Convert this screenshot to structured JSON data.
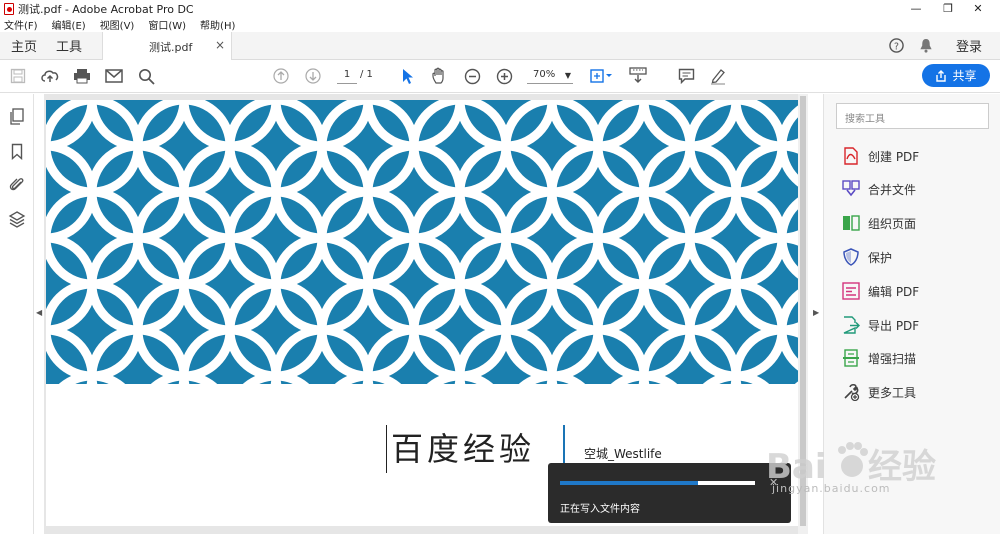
{
  "window": {
    "title": "测试.pdf - Adobe Acrobat Pro DC",
    "controls": {
      "minimize": "—",
      "restore": "❐",
      "close": "✕"
    }
  },
  "menu": [
    "文件(F)",
    "编辑(E)",
    "视图(V)",
    "窗口(W)",
    "帮助(H)"
  ],
  "tabs": {
    "home": "主页",
    "tools": "工具",
    "document": "测试.pdf",
    "close": "×",
    "login": "登录"
  },
  "toolbar": {
    "page_current": "1",
    "page_total": "/ 1",
    "zoom": "70%",
    "share_label": "共享"
  },
  "document": {
    "title": "百度经验",
    "author": "空城_Westlife",
    "pattern_color": "#1a7fae"
  },
  "progress": {
    "text": "正在写入文件内容",
    "fraction": 0.71,
    "close": "✕"
  },
  "tools_panel": {
    "search_placeholder": "搜索工具",
    "items": [
      {
        "label": "创建 PDF",
        "icon": "create-pdf-icon",
        "color": "#d9262b"
      },
      {
        "label": "合并文件",
        "icon": "combine-files-icon",
        "color": "#5b4bc4"
      },
      {
        "label": "组织页面",
        "icon": "organize-pages-icon",
        "color": "#3aa54a"
      },
      {
        "label": "保护",
        "icon": "shield-icon",
        "color": "#3b55b8"
      },
      {
        "label": "编辑 PDF",
        "icon": "edit-pdf-icon",
        "color": "#d4357d"
      },
      {
        "label": "导出 PDF",
        "icon": "export-pdf-icon",
        "color": "#219a7a"
      },
      {
        "label": "增强扫描",
        "icon": "scan-icon",
        "color": "#3aa54a"
      },
      {
        "label": "更多工具",
        "icon": "more-tools-icon",
        "color": "#444444"
      }
    ]
  },
  "watermark": {
    "text": "jingyan.baidu.com"
  }
}
